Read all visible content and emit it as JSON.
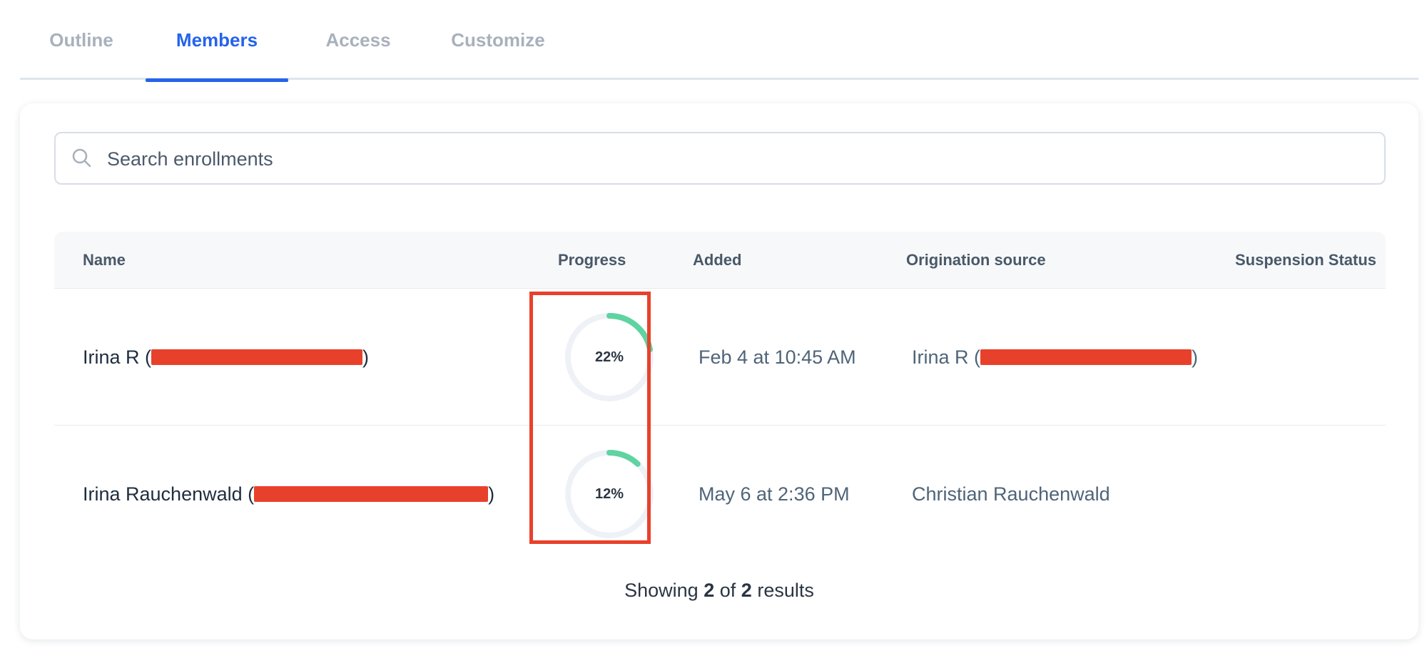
{
  "tabs": [
    {
      "label": "Outline",
      "active": false
    },
    {
      "label": "Members",
      "active": true
    },
    {
      "label": "Access",
      "active": false
    },
    {
      "label": "Customize",
      "active": false
    }
  ],
  "search": {
    "placeholder": "Search enrollments",
    "icon": "search-icon"
  },
  "table": {
    "columns": [
      "Name",
      "Progress",
      "Added",
      "Origination source",
      "Suspension Status"
    ],
    "rows": [
      {
        "name": "Irina R",
        "progress_label": "22%",
        "progress_value": 0.22,
        "added": "Feb 4 at 10:45 AM",
        "origination_source": "Irina R",
        "suspension_status": ""
      },
      {
        "name": "Irina Rauchenwald",
        "progress_label": "12%",
        "progress_value": 0.12,
        "added": "May 6 at 2:36 PM",
        "origination_source": "Christian Rauchenwald",
        "suspension_status": ""
      }
    ]
  },
  "footer": {
    "prefix": "Showing",
    "shown": "2",
    "of": "of",
    "total": "2",
    "suffix": "results"
  },
  "colors": {
    "accent": "#2563eb",
    "progress": "#5fd3a0",
    "track": "#eef2f7",
    "highlight": "#e8412b"
  }
}
